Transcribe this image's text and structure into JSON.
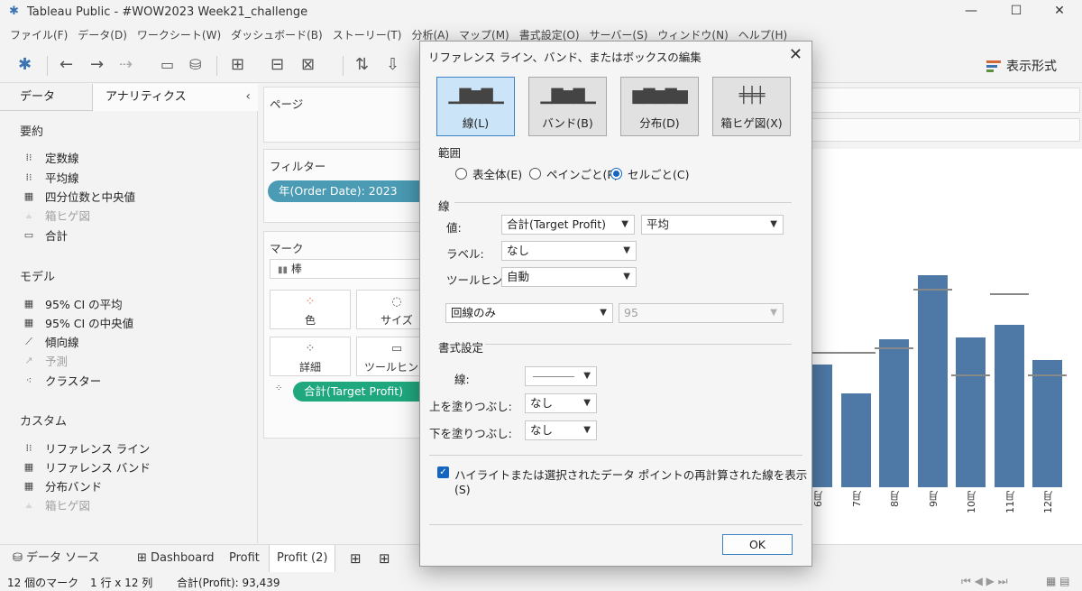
{
  "window": {
    "title": "Tableau Public - #WOW2023 Week21_challenge",
    "controls": {
      "minimize": "—",
      "maximize": "☐",
      "close": "✕"
    }
  },
  "menu": [
    "ファイル(F)",
    "データ(D)",
    "ワークシート(W)",
    "ダッシュボード(B)",
    "ストーリー(T)",
    "分析(A)",
    "マップ(M)",
    "書式設定(O)",
    "サーバー(S)",
    "ウィンドウ(N)",
    "ヘルプ(H)"
  ],
  "toolbar": {
    "format_label": "表示形式"
  },
  "left_panel": {
    "tabs": {
      "data": "データ",
      "analytics": "アナリティクス",
      "collapse": "‹"
    },
    "sections": [
      {
        "header": "要約",
        "items": [
          {
            "label": "定数線",
            "icon": "constant-line-icon",
            "enabled": true
          },
          {
            "label": "平均線",
            "icon": "average-line-icon",
            "enabled": true
          },
          {
            "label": "四分位数と中央値",
            "icon": "quartile-icon",
            "enabled": true
          },
          {
            "label": "箱ヒゲ図",
            "icon": "boxplot-icon",
            "enabled": false
          },
          {
            "label": "合計",
            "icon": "totals-icon",
            "enabled": true
          }
        ]
      },
      {
        "header": "モデル",
        "items": [
          {
            "label": "95% CI の平均",
            "icon": "ci-mean-icon",
            "enabled": true
          },
          {
            "label": "95% CI の中央値",
            "icon": "ci-median-icon",
            "enabled": true
          },
          {
            "label": "傾向線",
            "icon": "trend-line-icon",
            "enabled": true
          },
          {
            "label": "予測",
            "icon": "forecast-icon",
            "enabled": false
          },
          {
            "label": "クラスター",
            "icon": "cluster-icon",
            "enabled": true
          }
        ]
      },
      {
        "header": "カスタム",
        "items": [
          {
            "label": "リファレンス ライン",
            "icon": "reference-line-icon",
            "enabled": true
          },
          {
            "label": "リファレンス バンド",
            "icon": "reference-band-icon",
            "enabled": true
          },
          {
            "label": "分布バンド",
            "icon": "distribution-band-icon",
            "enabled": true
          },
          {
            "label": "箱ヒゲ図",
            "icon": "boxplot-icon",
            "enabled": false
          }
        ]
      }
    ]
  },
  "shelves": {
    "pages": "ページ",
    "filters": "フィルター",
    "filter_pill": "年(Order Date): 2023",
    "marks": "マーク",
    "mark_type": "棒",
    "mark_buttons": [
      "色",
      "サイズ",
      "詳細",
      "ツールヒント"
    ],
    "measure_pill": "合計(Target Profit)"
  },
  "chart_data": {
    "type": "bar",
    "categories": [
      "6月",
      "7月",
      "8月",
      "9月",
      "10月",
      "11月",
      "12月"
    ],
    "values": [
      0.545,
      0.415,
      0.655,
      0.94,
      0.665,
      0.72,
      0.565
    ],
    "ref_lines": [
      0.6,
      0.6,
      0.62,
      0.88,
      0.5,
      0.86,
      0.5
    ],
    "note_values": "relative bar heights (0-1) as shown; axis not visible"
  },
  "sheet_tabs": {
    "datasource": "データ ソース",
    "tabs": [
      "Dashboard",
      "Profit",
      "Profit (2)"
    ],
    "active": "Profit (2)"
  },
  "status": {
    "marks": "12 個のマーク",
    "dims": "1 行 x 12 列",
    "sum": "合計(Profit): 93,439"
  },
  "dialog": {
    "title": "リファレンス ライン、バンド、またはボックスの編集",
    "types": [
      {
        "label": "線(L)",
        "selected": true
      },
      {
        "label": "バンド(B)",
        "selected": false
      },
      {
        "label": "分布(D)",
        "selected": false
      },
      {
        "label": "箱ヒゲ図(X)",
        "selected": false
      }
    ],
    "scope": {
      "header": "範囲",
      "options": [
        {
          "label": "表全体(E)",
          "checked": false
        },
        {
          "label": "ペインごと(P)",
          "checked": false
        },
        {
          "label": "セルごと(C)",
          "checked": true
        }
      ]
    },
    "line": {
      "header": "線",
      "value_label": "値:",
      "value_field": "合計(Target Profit)",
      "value_agg": "平均",
      "label_label": "ラベル:",
      "label_value": "なし",
      "tooltip_label": "ツールヒント:",
      "tooltip_value": "自動",
      "line_only": "回線のみ",
      "ci_value": "95"
    },
    "format": {
      "header": "書式設定",
      "line_label": "線:",
      "fill_above_label": "上を塗りつぶし:",
      "fill_above_value": "なし",
      "fill_below_label": "下を塗りつぶし:",
      "fill_below_value": "なし"
    },
    "checkbox_label": "ハイライトまたは選択されたデータ ポイントの再計算された線を表示(S)",
    "ok": "OK"
  }
}
